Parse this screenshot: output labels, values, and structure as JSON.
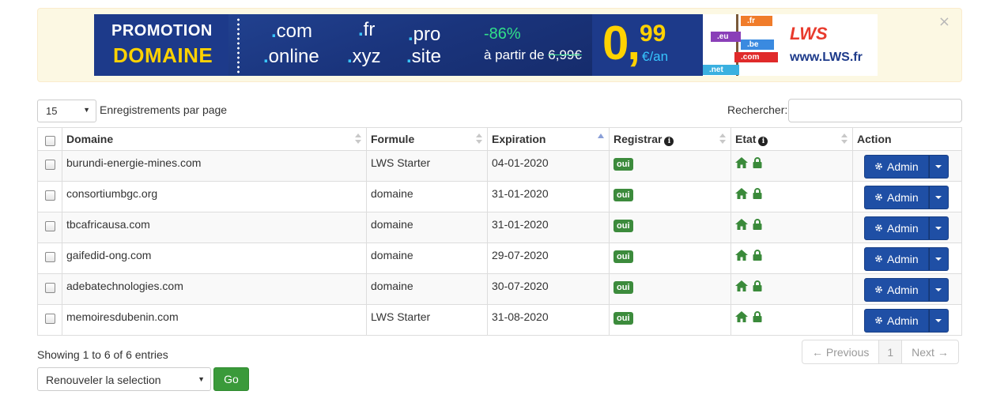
{
  "promo": {
    "title": "PROMOTION",
    "subtitle": "DOMAINE",
    "tlds": [
      ".com",
      ".fr",
      ".pro",
      ".online",
      ".xyz",
      ".site"
    ],
    "discount": "-86%",
    "from_label": "à partir de",
    "old_price": "6,99€",
    "price_main": "0,",
    "price_cents": "99",
    "per_year": "€/an",
    "flags": [
      ".fr",
      ".eu",
      ".be",
      ".com",
      ".net"
    ],
    "logo": "LWS",
    "url": "www.LWS.fr",
    "close": "×"
  },
  "controls": {
    "length_value": "15",
    "length_label": "Enregistrements par page",
    "search_label": "Rechercher:",
    "search_value": ""
  },
  "table": {
    "headers": [
      "Domaine",
      "Formule",
      "Expiration",
      "Registrar",
      "Etat",
      "Action"
    ],
    "rows": [
      {
        "domain": "burundi-energie-mines.com",
        "formule": "LWS Starter",
        "expiration": "04-01-2020",
        "registrar": "oui",
        "action": "Admin"
      },
      {
        "domain": "consortiumbgc.org",
        "formule": "domaine",
        "expiration": "31-01-2020",
        "registrar": "oui",
        "action": "Admin"
      },
      {
        "domain": "tbcafricausa.com",
        "formule": "domaine",
        "expiration": "31-01-2020",
        "registrar": "oui",
        "action": "Admin"
      },
      {
        "domain": "gaifedid-ong.com",
        "formule": "domaine",
        "expiration": "29-07-2020",
        "registrar": "oui",
        "action": "Admin"
      },
      {
        "domain": "adebatechnologies.com",
        "formule": "domaine",
        "expiration": "30-07-2020",
        "registrar": "oui",
        "action": "Admin"
      },
      {
        "domain": "memoiresdubenin.com",
        "formule": "LWS Starter",
        "expiration": "31-08-2020",
        "registrar": "oui",
        "action": "Admin"
      }
    ]
  },
  "footer": {
    "showing": "Showing 1 to 6 of 6 entries",
    "prev": "← Previous",
    "page": "1",
    "next": "Next →",
    "bulk_value": "Renouveler la selection",
    "go": "Go"
  },
  "colors": {
    "primary": "#1f4fa5",
    "success": "#3c8b3c",
    "promo_bg": "#1d3a8a",
    "promo_yellow": "#ffd200"
  }
}
